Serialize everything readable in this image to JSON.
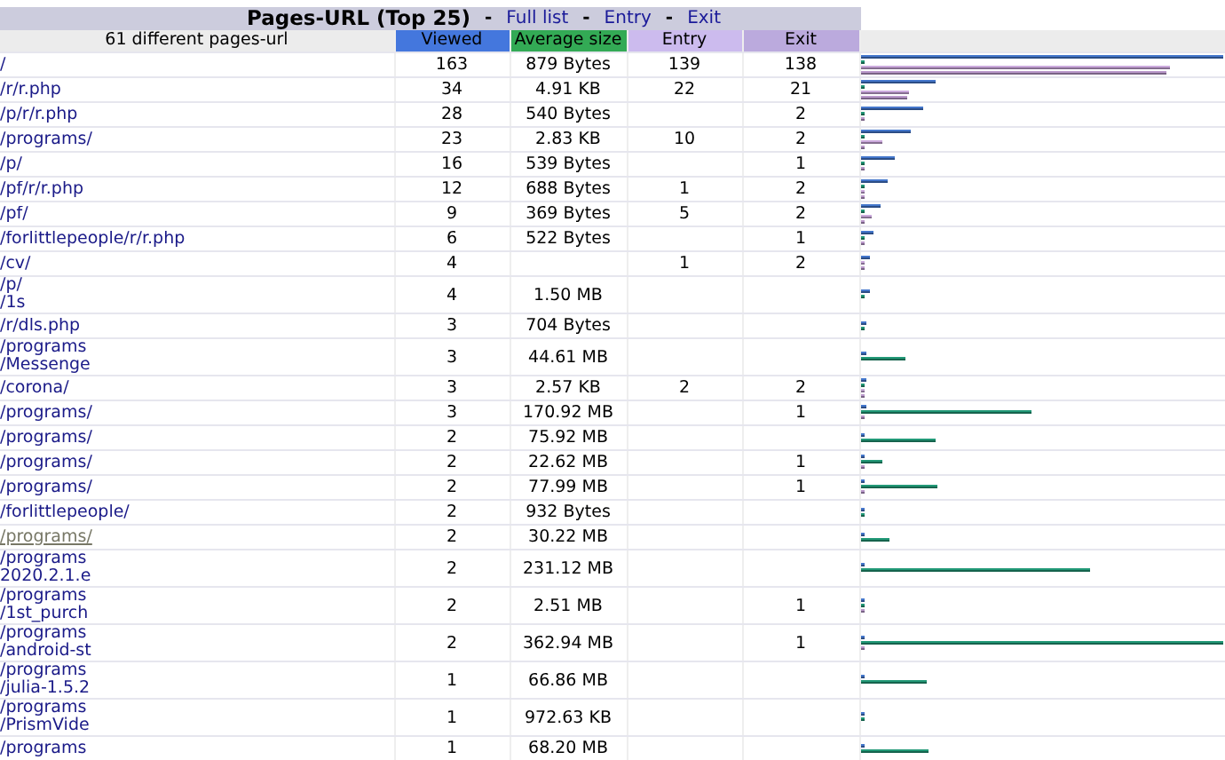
{
  "title": {
    "text": "Pages-URL (Top 25)",
    "separators": [
      "-",
      "-",
      "-"
    ],
    "links": [
      "Full list",
      "Entry",
      "Exit"
    ]
  },
  "columns": [
    {
      "kind": "url",
      "label": "61 different pages-url"
    },
    {
      "kind": "viewed",
      "label": "Viewed"
    },
    {
      "kind": "size",
      "label": "Average size"
    },
    {
      "kind": "entry",
      "label": "Entry"
    },
    {
      "kind": "exit",
      "label": "Exit"
    }
  ],
  "rows": [
    {
      "url": [
        "/"
      ],
      "hovered": false,
      "viewed": "163",
      "size": "879 Bytes",
      "entry": "139",
      "exit": "138",
      "bars": [
        {
          "kind": "viewed",
          "level": 1
        },
        {
          "kind": "size",
          "level": 0
        },
        {
          "kind": "entry",
          "level": 0.853
        },
        {
          "kind": "exit",
          "level": 0.847
        }
      ]
    },
    {
      "url": [
        "/r/r.php"
      ],
      "hovered": false,
      "viewed": "34",
      "size": "4.91 KB",
      "entry": "22",
      "exit": "21",
      "bars": [
        {
          "kind": "viewed",
          "level": 0.209
        },
        {
          "kind": "size",
          "level": 0
        },
        {
          "kind": "entry",
          "level": 0.135
        },
        {
          "kind": "exit",
          "level": 0.129
        }
      ]
    },
    {
      "url": [
        "/p/r/r.php"
      ],
      "hovered": false,
      "viewed": "28",
      "size": "540 Bytes",
      "exit": "2",
      "bars": [
        {
          "kind": "viewed",
          "level": 0.172
        },
        {
          "kind": "size",
          "level": 0
        },
        {
          "kind": "exit",
          "level": 0.012
        }
      ]
    },
    {
      "url": [
        "/programs/"
      ],
      "hovered": false,
      "viewed": "23",
      "size": "2.83 KB",
      "entry": "10",
      "exit": "2",
      "bars": [
        {
          "kind": "viewed",
          "level": 0.141
        },
        {
          "kind": "size",
          "level": 0
        },
        {
          "kind": "entry",
          "level": 0.061
        },
        {
          "kind": "exit",
          "level": 0.012
        }
      ]
    },
    {
      "url": [
        "/p/"
      ],
      "hovered": false,
      "viewed": "16",
      "size": "539 Bytes",
      "exit": "1",
      "bars": [
        {
          "kind": "viewed",
          "level": 0.098
        },
        {
          "kind": "size",
          "level": 0
        },
        {
          "kind": "exit",
          "level": 0.006
        }
      ]
    },
    {
      "url": [
        "/pf/r/r.php"
      ],
      "hovered": false,
      "viewed": "12",
      "size": "688 Bytes",
      "entry": "1",
      "exit": "2",
      "bars": [
        {
          "kind": "viewed",
          "level": 0.074
        },
        {
          "kind": "size",
          "level": 0
        },
        {
          "kind": "entry",
          "level": 0.006
        },
        {
          "kind": "exit",
          "level": 0.012
        }
      ]
    },
    {
      "url": [
        "/pf/"
      ],
      "hovered": false,
      "viewed": "9",
      "size": "369 Bytes",
      "entry": "5",
      "exit": "2",
      "bars": [
        {
          "kind": "viewed",
          "level": 0.055
        },
        {
          "kind": "size",
          "level": 0
        },
        {
          "kind": "entry",
          "level": 0.031
        },
        {
          "kind": "exit",
          "level": 0.012
        }
      ]
    },
    {
      "url": [
        "/forlittlepeople/r/r.php"
      ],
      "hovered": false,
      "viewed": "6",
      "size": "522 Bytes",
      "exit": "1",
      "bars": [
        {
          "kind": "viewed",
          "level": 0.037
        },
        {
          "kind": "size",
          "level": 0
        },
        {
          "kind": "exit",
          "level": 0.006
        }
      ]
    },
    {
      "url": [
        "/cv/"
      ],
      "hovered": false,
      "viewed": "4",
      "entry": "1",
      "exit": "2",
      "bars": [
        {
          "kind": "viewed",
          "level": 0.025
        },
        {
          "kind": "entry",
          "level": 0.006
        },
        {
          "kind": "exit",
          "level": 0.012
        }
      ]
    },
    {
      "url": [
        "/p/",
        "/1s"
      ],
      "hovered": false,
      "viewed": "4",
      "size": "1.50 MB",
      "bars": [
        {
          "kind": "viewed",
          "level": 0.025
        },
        {
          "kind": "size",
          "level": 0.004
        }
      ]
    },
    {
      "url": [
        "/r/dls.php"
      ],
      "hovered": false,
      "viewed": "3",
      "size": "704 Bytes",
      "bars": [
        {
          "kind": "viewed",
          "level": 0.018
        },
        {
          "kind": "size",
          "level": 0
        }
      ]
    },
    {
      "url": [
        "/programs",
        "/Messenge"
      ],
      "hovered": false,
      "viewed": "3",
      "size": "44.61 MB",
      "bars": [
        {
          "kind": "viewed",
          "level": 0.018
        },
        {
          "kind": "size",
          "level": 0.123
        }
      ]
    },
    {
      "url": [
        "/corona/"
      ],
      "hovered": false,
      "viewed": "3",
      "size": "2.57 KB",
      "entry": "2",
      "exit": "2",
      "bars": [
        {
          "kind": "viewed",
          "level": 0.018
        },
        {
          "kind": "size",
          "level": 0
        },
        {
          "kind": "entry",
          "level": 0.012
        },
        {
          "kind": "exit",
          "level": 0.012
        }
      ]
    },
    {
      "url": [
        "/programs/"
      ],
      "hovered": false,
      "viewed": "3",
      "size": "170.92 MB",
      "exit": "1",
      "bars": [
        {
          "kind": "viewed",
          "level": 0.018
        },
        {
          "kind": "size",
          "level": 0.471
        },
        {
          "kind": "exit",
          "level": 0.006
        }
      ]
    },
    {
      "url": [
        "/programs/"
      ],
      "hovered": false,
      "viewed": "2",
      "size": "75.92 MB",
      "bars": [
        {
          "kind": "viewed",
          "level": 0.012
        },
        {
          "kind": "size",
          "level": 0.209
        }
      ]
    },
    {
      "url": [
        "/programs/"
      ],
      "hovered": false,
      "viewed": "2",
      "size": "22.62 MB",
      "exit": "1",
      "bars": [
        {
          "kind": "viewed",
          "level": 0.012
        },
        {
          "kind": "size",
          "level": 0.062
        },
        {
          "kind": "exit",
          "level": 0.006
        }
      ]
    },
    {
      "url": [
        "/programs/"
      ],
      "hovered": false,
      "viewed": "2",
      "size": "77.99 MB",
      "exit": "1",
      "bars": [
        {
          "kind": "viewed",
          "level": 0.012
        },
        {
          "kind": "size",
          "level": 0.215
        },
        {
          "kind": "exit",
          "level": 0.006
        }
      ]
    },
    {
      "url": [
        "/forlittlepeople/"
      ],
      "hovered": false,
      "viewed": "2",
      "size": "932 Bytes",
      "bars": [
        {
          "kind": "viewed",
          "level": 0.012
        },
        {
          "kind": "size",
          "level": 0
        }
      ]
    },
    {
      "url": [
        "/programs/"
      ],
      "hovered": true,
      "viewed": "2",
      "size": "30.22 MB",
      "bars": [
        {
          "kind": "viewed",
          "level": 0.012
        },
        {
          "kind": "size",
          "level": 0.083
        }
      ]
    },
    {
      "url": [
        "/programs",
        "2020.2.1.e"
      ],
      "hovered": false,
      "viewed": "2",
      "size": "231.12 MB",
      "bars": [
        {
          "kind": "viewed",
          "level": 0.012
        },
        {
          "kind": "size",
          "level": 0.637
        }
      ]
    },
    {
      "url": [
        "/programs",
        "/1st_purch"
      ],
      "hovered": false,
      "viewed": "2",
      "size": "2.51 MB",
      "exit": "1",
      "bars": [
        {
          "kind": "viewed",
          "level": 0.012
        },
        {
          "kind": "size",
          "level": 0.007
        },
        {
          "kind": "exit",
          "level": 0.006
        }
      ]
    },
    {
      "url": [
        "/programs",
        "/android-st"
      ],
      "hovered": false,
      "viewed": "2",
      "size": "362.94 MB",
      "exit": "1",
      "bars": [
        {
          "kind": "viewed",
          "level": 0.012
        },
        {
          "kind": "size",
          "level": 1
        },
        {
          "kind": "exit",
          "level": 0.006
        }
      ]
    },
    {
      "url": [
        "/programs",
        "/julia-1.5.2"
      ],
      "hovered": false,
      "viewed": "1",
      "size": "66.86 MB",
      "bars": [
        {
          "kind": "viewed",
          "level": 0.006
        },
        {
          "kind": "size",
          "level": 0.184
        }
      ]
    },
    {
      "url": [
        "/programs",
        "/PrismVide"
      ],
      "hovered": false,
      "viewed": "1",
      "size": "972.63 KB",
      "bars": [
        {
          "kind": "viewed",
          "level": 0.006
        },
        {
          "kind": "size",
          "level": 0.003
        }
      ]
    },
    {
      "url": [
        "/programs"
      ],
      "hovered": false,
      "viewed": "1",
      "size": "68.20 MB",
      "bars": [
        {
          "kind": "viewed",
          "level": 0.006
        },
        {
          "kind": "size",
          "level": 0.188
        }
      ]
    }
  ]
}
